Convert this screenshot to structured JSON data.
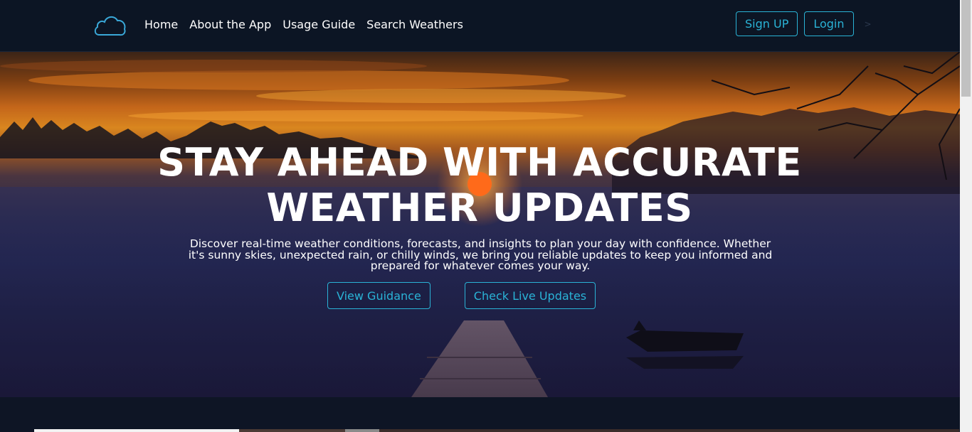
{
  "navbar": {
    "logo_icon": "cloud-icon",
    "links": [
      {
        "label": "Home"
      },
      {
        "label": "About the App"
      },
      {
        "label": "Usage Guide"
      },
      {
        "label": "Search Weathers"
      }
    ],
    "signup_label": "Sign UP",
    "login_label": "Login",
    "chevron": ">"
  },
  "hero": {
    "title_line1": "STAY AHEAD WITH ACCURATE",
    "title_line2": "WEATHER UPDATES",
    "description_line1": "Discover real-time weather conditions, forecasts, and insights to plan your day with confidence. Whether",
    "description_line2": "it's sunny skies, unexpected rain, or chilly winds, we bring you reliable updates to keep you informed and",
    "description_line3": "prepared for whatever comes your way.",
    "primary_button": "View Guidance",
    "secondary_button": "Check Live Updates",
    "background_image": "sunset-lake-dock-scene"
  },
  "colors": {
    "accent": "#2ab3d6",
    "nav_bg": "#0c1524",
    "text": "#ffffff"
  }
}
